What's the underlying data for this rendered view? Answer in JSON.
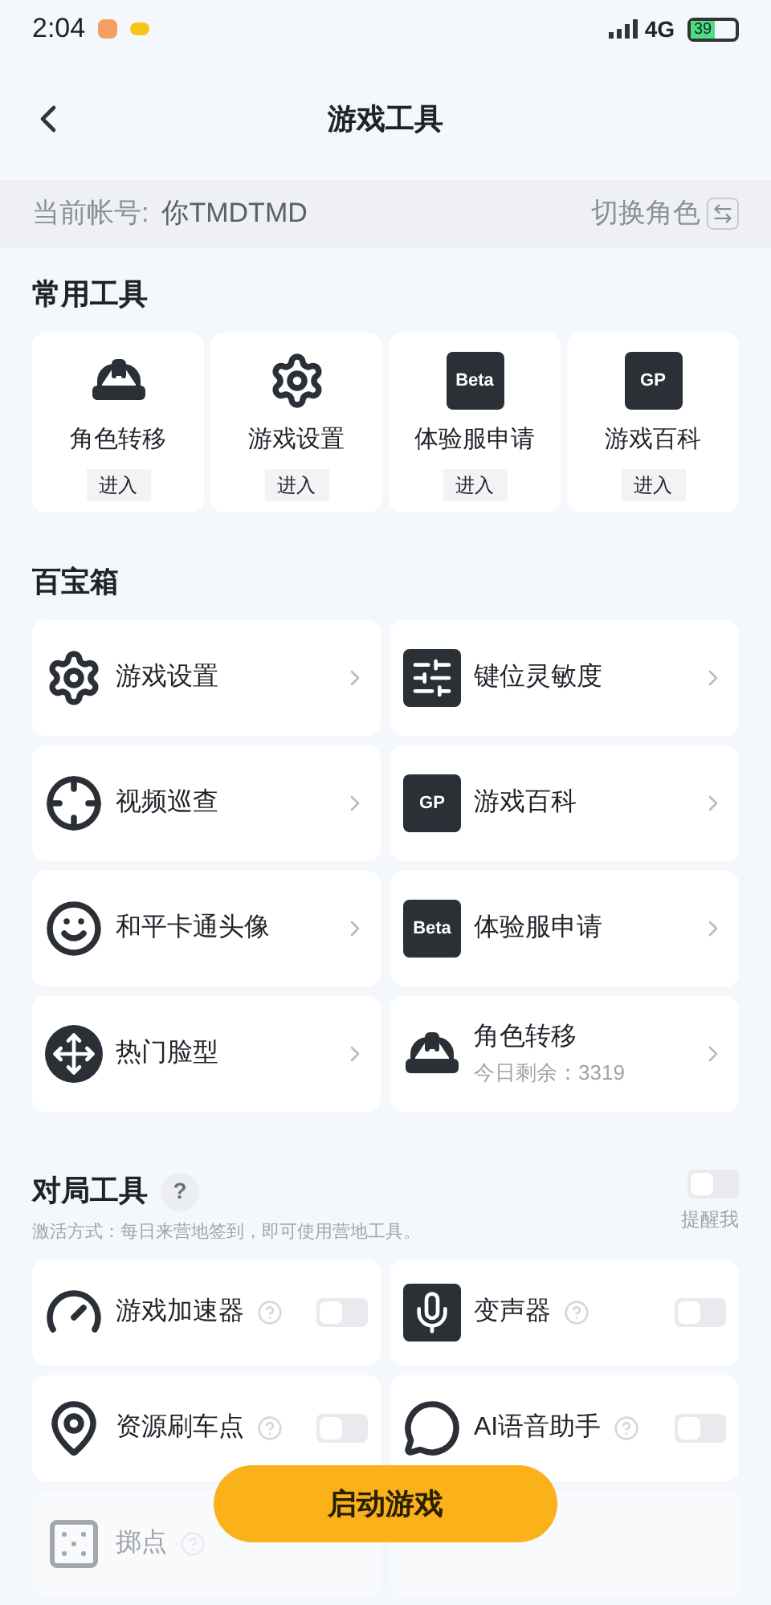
{
  "status_bar": {
    "time": "2:04",
    "network": "4G",
    "battery": "39"
  },
  "header": {
    "title": "游戏工具"
  },
  "account": {
    "label": "当前帐号:",
    "name": "你TMDTMD",
    "switch_label": "切换角色"
  },
  "common_tools": {
    "title": "常用工具",
    "items": [
      {
        "label": "角色转移",
        "action": "进入"
      },
      {
        "label": "游戏设置",
        "action": "进入"
      },
      {
        "label": "体验服申请",
        "action": "进入",
        "badge": "Beta"
      },
      {
        "label": "游戏百科",
        "action": "进入",
        "badge": "GP"
      }
    ]
  },
  "toolbox": {
    "title": "百宝箱",
    "items": [
      {
        "label": "游戏设置"
      },
      {
        "label": "键位灵敏度"
      },
      {
        "label": "视频巡查"
      },
      {
        "label": "游戏百科",
        "badge": "GP"
      },
      {
        "label": "和平卡通头像"
      },
      {
        "label": "体验服申请",
        "badge": "Beta"
      },
      {
        "label": "热门脸型"
      },
      {
        "label": "角色转移",
        "note": "今日剩余：3319"
      }
    ]
  },
  "battle_tools": {
    "title": "对局工具",
    "help": "?",
    "hint": "激活方式：每日来营地签到，即可使用营地工具。",
    "remind": {
      "label": "提醒我",
      "on": false
    },
    "items": [
      {
        "label": "游戏加速器",
        "on": false
      },
      {
        "label": "变声器",
        "on": false
      },
      {
        "label": "资源刷车点",
        "on": false
      },
      {
        "label": "AI语音助手",
        "on": false
      },
      {
        "label": "掷点"
      }
    ]
  },
  "start_button": "启动游戏"
}
